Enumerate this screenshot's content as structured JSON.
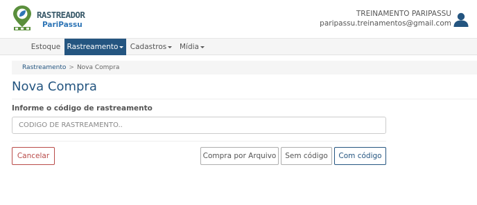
{
  "header": {
    "brand_title": "RASTREADOR",
    "brand_subtitle": "PariPassu",
    "user_name": "TREINAMENTO PARIPASSU",
    "user_email": "paripassu.treinamentos@gmail.com",
    "colors": {
      "brand_green": "#5a8f3c",
      "brand_blue": "#2e75b6",
      "nav_active": "#245580"
    },
    "icons": {
      "logo": "location-pin-leaf-logo",
      "user": "user-icon"
    }
  },
  "nav": {
    "items": [
      {
        "label": "Estoque",
        "active": false,
        "dropdown": false
      },
      {
        "label": "Rastreamento",
        "active": true,
        "dropdown": true
      },
      {
        "label": "Cadastros",
        "active": false,
        "dropdown": true
      },
      {
        "label": "Mídia",
        "active": false,
        "dropdown": true
      }
    ]
  },
  "breadcrumb": {
    "link": "Rastreamento",
    "separator": ">",
    "current": "Nova Compra"
  },
  "page": {
    "title": "Nova Compra"
  },
  "form": {
    "label": "Informe o código de rastreamento",
    "input_value": "",
    "input_placeholder": "CÓDIGO DE RASTREAMENTO.."
  },
  "buttons": {
    "cancel": "Cancelar",
    "by_file": "Compra por Arquivo",
    "without_code": "Sem código",
    "with_code": "Com código"
  }
}
